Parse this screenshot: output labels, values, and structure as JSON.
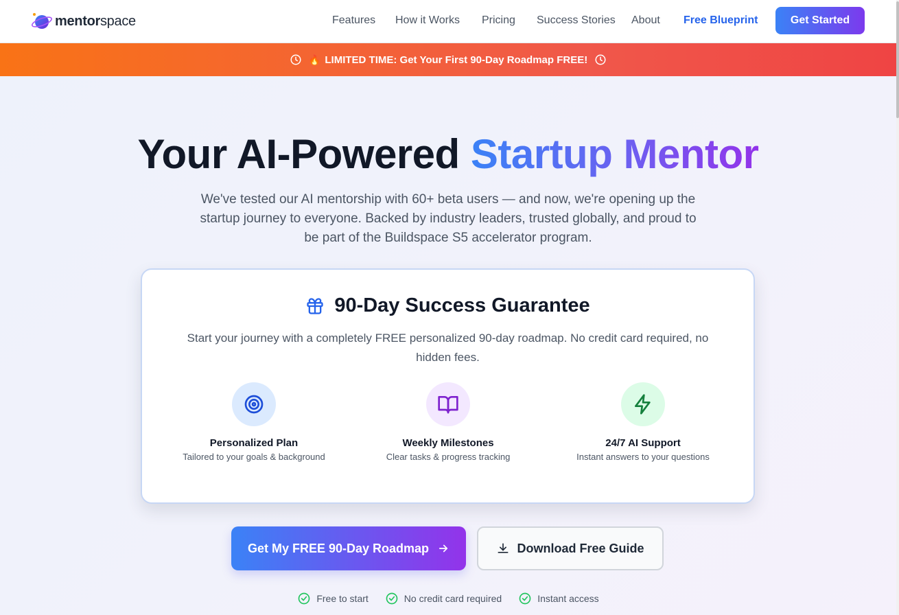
{
  "nav": {
    "logo_text_bold": "mentor",
    "logo_text_rest": "space",
    "links": [
      "Features",
      "How it Works",
      "Pricing",
      "Success Stories",
      "About"
    ],
    "free_blueprint": "Free Blueprint",
    "get_started": "Get Started"
  },
  "banner": {
    "text": "LIMITED TIME: Get Your First 90-Day Roadmap FREE!",
    "emoji": "🔥",
    "colors": [
      "#f97316",
      "#ef4444"
    ]
  },
  "hero": {
    "title_plain": "Your AI-Powered ",
    "title_gradient": "Startup Mentor",
    "subtitle": "We've tested our AI mentorship with 60+ beta users — and now, we're opening up the startup journey to everyone. Backed by industry leaders, trusted globally, and proud to be part of the Buildspace S5 accelerator program."
  },
  "card": {
    "icon": "gift-icon",
    "title": "90-Day Success Guarantee",
    "description": "Start your journey with a completely FREE personalized 90-day roadmap. No credit card required, no hidden fees.",
    "features": [
      {
        "icon": "target-icon",
        "title": "Personalized Plan",
        "subtitle": "Tailored to your goals & background",
        "color": "#1d4ed8",
        "bg": "#dbeafe"
      },
      {
        "icon": "book-open-icon",
        "title": "Weekly Milestones",
        "subtitle": "Clear tasks & progress tracking",
        "color": "#7e22ce",
        "bg": "#f3e8ff"
      },
      {
        "icon": "lightning-icon",
        "title": "24/7 AI Support",
        "subtitle": "Instant answers to your questions",
        "color": "#15803d",
        "bg": "#dcfce7"
      }
    ]
  },
  "cta": {
    "primary": "Get My FREE 90-Day Roadmap",
    "secondary": "Download Free Guide"
  },
  "checks": [
    "Free to start",
    "No credit card required",
    "Instant access"
  ],
  "colors": {
    "accent_blue": "#3b82f6",
    "accent_purple": "#9333ea",
    "check_green": "#22c55e"
  }
}
